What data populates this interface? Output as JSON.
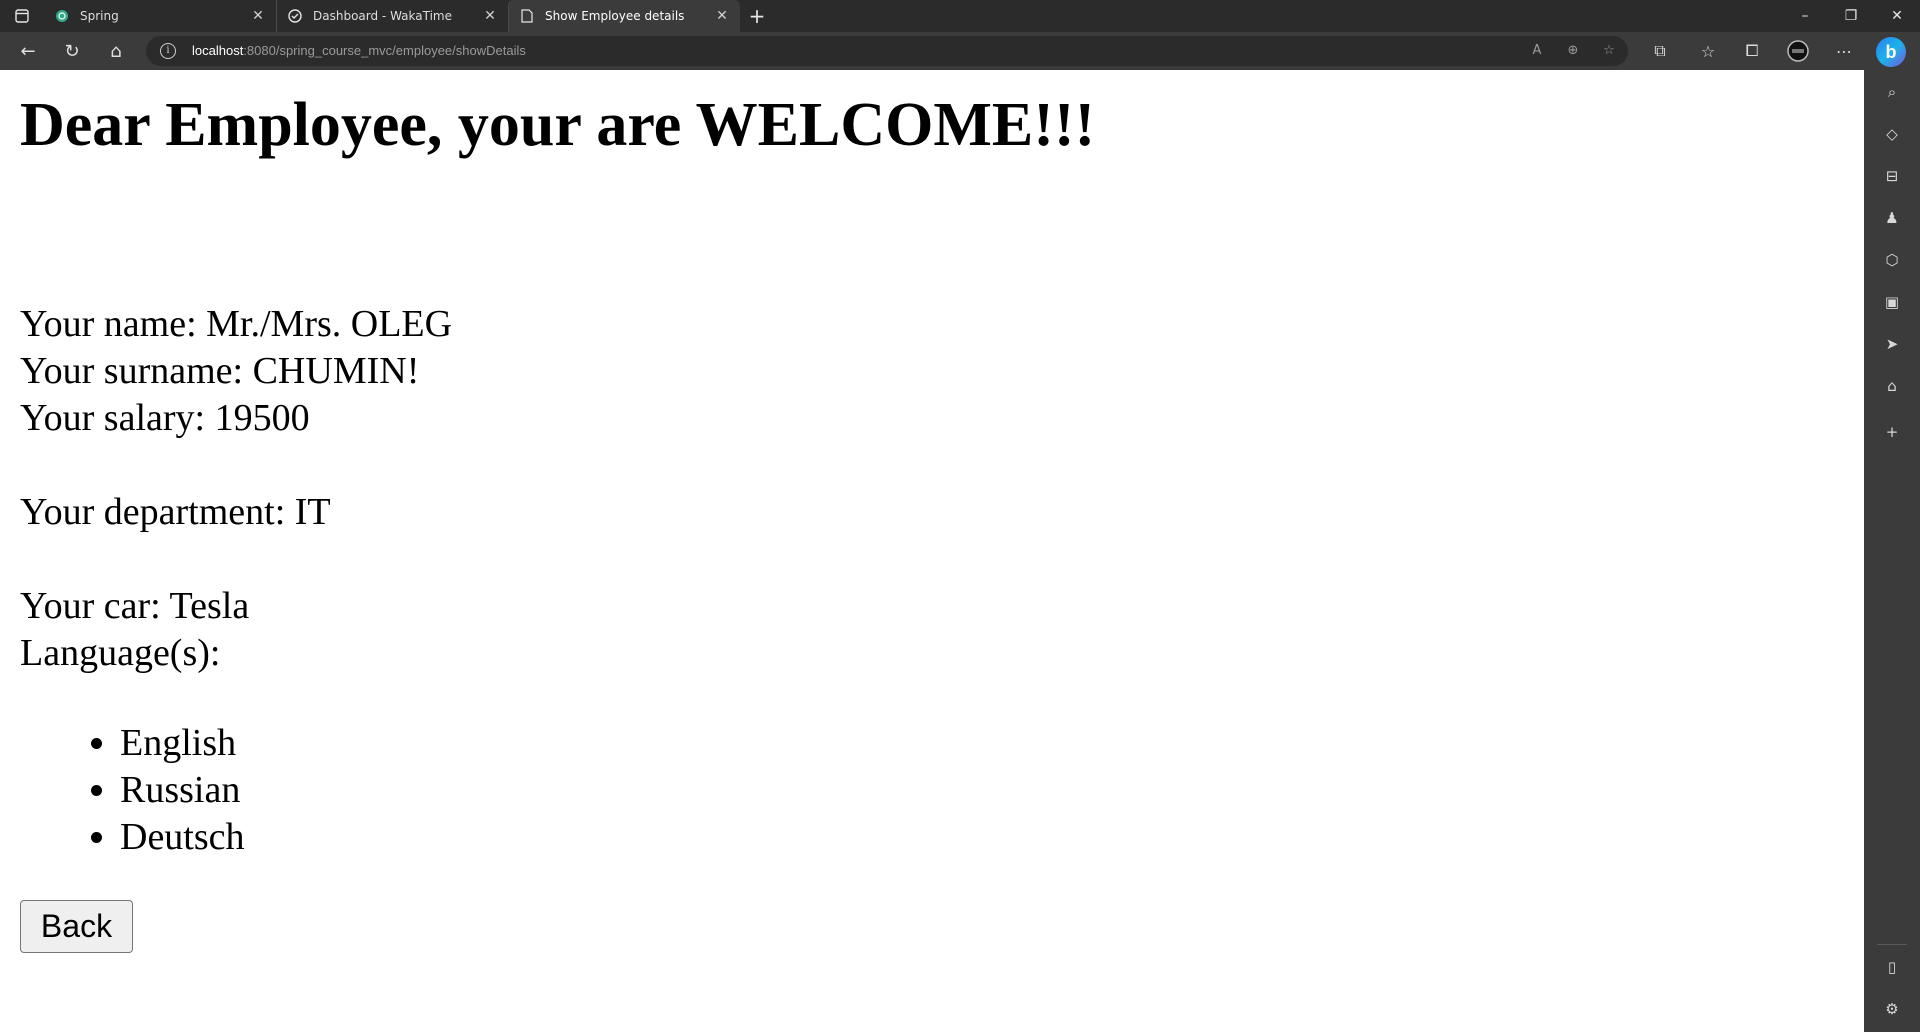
{
  "browser": {
    "tabs": [
      {
        "title": "Spring",
        "icon": "chatgpt-icon",
        "active": false
      },
      {
        "title": "Dashboard - WakaTime",
        "icon": "wakatime-icon",
        "active": false
      },
      {
        "title": "Show Employee details",
        "icon": "page-icon",
        "active": true
      }
    ],
    "address": {
      "host": "localhost",
      "path": ":8080/spring_course_mvc/employee/showDetails"
    },
    "copilot_letter": "b"
  },
  "page": {
    "heading": "Dear Employee, your are WELCOME!!!",
    "name_line": "Your name: Mr./Mrs. OLEG",
    "surname_line": "Your surname: CHUMIN!",
    "salary_line": "Your salary: 19500",
    "department_line": "Your department: IT",
    "car_line": "Your car: Tesla",
    "languages_label": "Language(s):",
    "languages": [
      "English",
      "Russian",
      "Deutsch"
    ],
    "back_label": "Back"
  }
}
